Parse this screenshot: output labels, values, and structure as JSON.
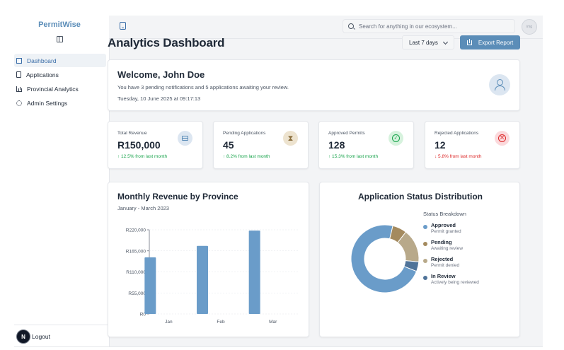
{
  "sidebar": {
    "brand": "PermitWise",
    "items": [
      {
        "label": "Dashboard",
        "icon": "dashboard-grid-icon",
        "active": true
      },
      {
        "label": "Applications",
        "icon": "document-icon"
      },
      {
        "label": "Provincial Analytics",
        "icon": "bar-chart-icon"
      },
      {
        "label": "Admin Settings",
        "icon": "gear-icon"
      }
    ],
    "logout_label": "Logout",
    "badge_letter": "N"
  },
  "topbar": {
    "search_placeholder": "Search for anything in our ecosystem...",
    "avatar_text": "img"
  },
  "header": {
    "title": "Analytics Dashboard",
    "range_label": "Last 7 days",
    "export_label": "Export Report"
  },
  "welcome": {
    "title": "Welcome, John Doe",
    "subtitle": "You have 3 pending notifications and 5 applications awaiting your review.",
    "date": "Tuesday, 10 June 2025 at 09:17:13"
  },
  "stats": [
    {
      "label": "Total Revenue",
      "value": "R150,000",
      "change": "↑ 12.5% from last month",
      "trend": "up",
      "icon": "credit-card-icon"
    },
    {
      "label": "Pending Applications",
      "value": "45",
      "change": "↑ 8.2% from last month",
      "trend": "up",
      "icon": "hourglass-icon"
    },
    {
      "label": "Approved Permits",
      "value": "128",
      "change": "↑ 15.3% from last month",
      "trend": "up",
      "icon": "check-circle-icon"
    },
    {
      "label": "Rejected Applications",
      "value": "12",
      "change": "↓ 5.8% from last month",
      "trend": "down",
      "icon": "x-circle-icon"
    }
  ],
  "revenue_chart": {
    "title": "Monthly Revenue by Province",
    "subtitle": "January - March 2023"
  },
  "status_chart": {
    "title": "Application Status Distribution",
    "legend_title": "Status Breakdown",
    "legend": [
      {
        "name": "Approved",
        "desc": "Permit granted"
      },
      {
        "name": "Pending",
        "desc": "Awaiting review"
      },
      {
        "name": "Rejected",
        "desc": "Permit denied"
      },
      {
        "name": "In Review",
        "desc": "Actively being reviewed"
      }
    ]
  },
  "colors": {
    "accent": "#5b8db8",
    "approved": "#6a9cc9",
    "pending": "#a48a5e",
    "rejected": "#b8a98a",
    "in_review": "#4f7399"
  },
  "chart_data": [
    {
      "type": "bar",
      "title": "Monthly Revenue by Province",
      "subtitle": "January - March 2023",
      "categories": [
        "Jan",
        "Feb",
        "Mar"
      ],
      "values": [
        148000,
        178000,
        218000
      ],
      "ylim": [
        0,
        220000
      ],
      "yticks": [
        0,
        55000,
        110000,
        165000,
        220000
      ],
      "ytick_labels": [
        "R0",
        "R55,000",
        "R110,000",
        "R165,000",
        "R220,000"
      ],
      "color": "#6a9cc9",
      "grid": true
    },
    {
      "type": "pie",
      "title": "Application Status Distribution",
      "labels": [
        "Approved",
        "Pending",
        "Rejected",
        "In Review"
      ],
      "values": [
        128,
        12,
        28,
        8
      ],
      "colors": [
        "#6a9cc9",
        "#a48a5e",
        "#b8a98a",
        "#4f7399"
      ]
    }
  ]
}
